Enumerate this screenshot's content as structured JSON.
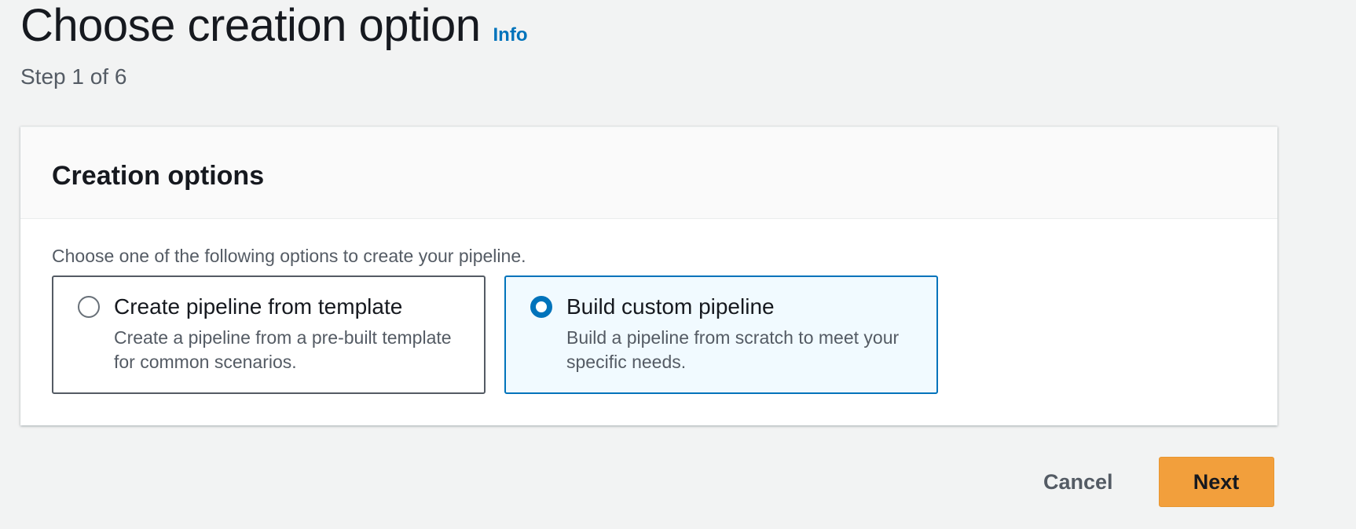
{
  "header": {
    "title": "Choose creation option",
    "info_link": "Info",
    "step": "Step 1 of 6"
  },
  "panel": {
    "title": "Creation options",
    "description": "Choose one of the following options to create your pipeline.",
    "options": [
      {
        "label": "Create pipeline from template",
        "description": "Create a pipeline from a pre-built template for common scenarios.",
        "selected": false
      },
      {
        "label": "Build custom pipeline",
        "description": "Build a pipeline from scratch to meet your specific needs.",
        "selected": true
      }
    ]
  },
  "actions": {
    "cancel_label": "Cancel",
    "next_label": "Next"
  },
  "colors": {
    "accent": "#0073bb",
    "primary_button": "#f29f3c",
    "selected_tile_bg": "#f1faff",
    "page_bg": "#f2f3f3"
  }
}
